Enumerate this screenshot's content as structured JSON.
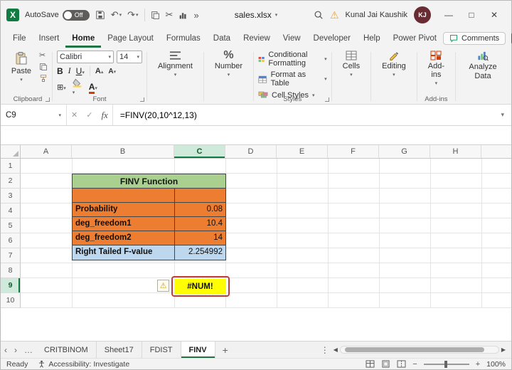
{
  "colors": {
    "excel_green": "#217346",
    "table_header_fill": "#A9D08E",
    "input_fill": "#ED7D31",
    "result_fill": "#BDD7EE",
    "error_fill": "#FFFF00",
    "error_border": "#C43A36"
  },
  "titlebar": {
    "autosave_label": "AutoSave",
    "autosave_state": "Off",
    "filename": "sales.xlsx",
    "user_name": "Kunal Jai Kaushik",
    "user_initials": "KJ"
  },
  "tabs": {
    "items": [
      "File",
      "Insert",
      "Home",
      "Page Layout",
      "Formulas",
      "Data",
      "Review",
      "View",
      "Developer",
      "Help",
      "Power Pivot"
    ],
    "active": "Home"
  },
  "actions": {
    "comments": "Comments"
  },
  "ribbon": {
    "paste": "Paste",
    "clipboard_group": "Clipboard",
    "font_name": "Calibri",
    "font_size": "14",
    "bold": "B",
    "italic": "I",
    "underline": "U",
    "font_group": "Font",
    "alignment": "Alignment",
    "number": "Number",
    "conditional_formatting": "Conditional Formatting",
    "format_as_table": "Format as Table",
    "cell_styles": "Cell Styles",
    "styles_group": "Styles",
    "cells": "Cells",
    "editing": "Editing",
    "addins": "Add-ins",
    "addins_group": "Add-ins",
    "analyze_data": "Analyze Data"
  },
  "formula_bar": {
    "name_box": "C9",
    "fx": "fx",
    "formula": "=FINV(20,10^12,13)"
  },
  "grid": {
    "columns": [
      "A",
      "B",
      "C",
      "D",
      "E",
      "F",
      "G",
      "H"
    ],
    "selected_column": "C",
    "rows": [
      "1",
      "2",
      "3",
      "4",
      "5",
      "6",
      "7",
      "8",
      "9",
      "10"
    ],
    "selected_row": "9"
  },
  "worksheet": {
    "table": {
      "title": "FINV Function",
      "rows": [
        {
          "label": "Probability",
          "value": "0.08"
        },
        {
          "label": "deg_freedom1",
          "value": "10.4"
        },
        {
          "label": "deg_freedom2",
          "value": "14"
        },
        {
          "label": "Right Tailed F-value",
          "value": "2.254992"
        }
      ]
    },
    "error_value": "#NUM!"
  },
  "sheet_tabs": {
    "items": [
      "CRITBINOM",
      "Sheet17",
      "FDIST",
      "FINV"
    ],
    "active": "FINV"
  },
  "status_bar": {
    "ready": "Ready",
    "accessibility": "Accessibility: Investigate",
    "zoom": "100%"
  }
}
